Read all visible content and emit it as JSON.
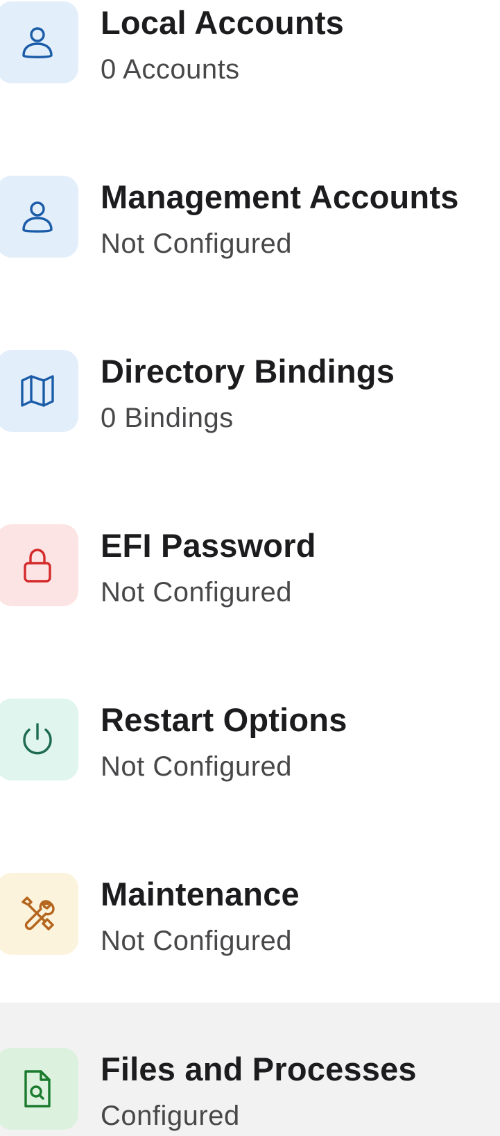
{
  "items": [
    {
      "title": "Local Accounts",
      "subtitle": "0 Accounts",
      "icon": "person-icon",
      "tile_color": "#e3eefb",
      "icon_color": "#1a5ca8"
    },
    {
      "title": "Management Accounts",
      "subtitle": "Not Configured",
      "icon": "person-icon",
      "tile_color": "#e3eefb",
      "icon_color": "#1a5ca8"
    },
    {
      "title": "Directory Bindings",
      "subtitle": "0 Bindings",
      "icon": "map-icon",
      "tile_color": "#e3eefb",
      "icon_color": "#1a5ca8"
    },
    {
      "title": "EFI Password",
      "subtitle": "Not Configured",
      "icon": "lock-icon",
      "tile_color": "#fde4e4",
      "icon_color": "#d42a2a"
    },
    {
      "title": "Restart Options",
      "subtitle": "Not Configured",
      "icon": "power-icon",
      "tile_color": "#dff5ee",
      "icon_color": "#1f6b50"
    },
    {
      "title": "Maintenance",
      "subtitle": "Not Configured",
      "icon": "wrench-screwdriver-icon",
      "tile_color": "#fbf3dc",
      "icon_color": "#b5651d"
    },
    {
      "title": "Files and Processes",
      "subtitle": "Configured",
      "icon": "file-search-icon",
      "tile_color": "#dcf2df",
      "icon_color": "#1b7a2e",
      "selected": true
    }
  ]
}
